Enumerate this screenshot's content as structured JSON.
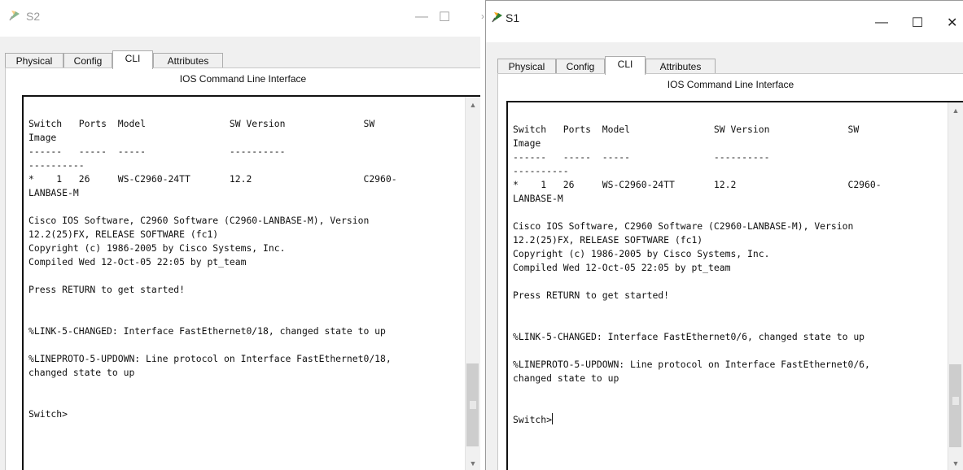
{
  "windows": [
    {
      "title": "S2",
      "controls": {
        "minimize": "—",
        "maximize": "☐"
      },
      "tabs": [
        "Physical",
        "Config",
        "CLI",
        "Attributes"
      ],
      "active_tab": "CLI",
      "panel_title": "IOS Command Line Interface",
      "terminal_text": "\nSwitch   Ports  Model               SW Version              SW\nImage\n------   -----  -----               ----------\n----------\n*    1   26     WS-C2960-24TT       12.2                    C2960-\nLANBASE-M\n\nCisco IOS Software, C2960 Software (C2960-LANBASE-M), Version\n12.2(25)FX, RELEASE SOFTWARE (fc1)\nCopyright (c) 1986-2005 by Cisco Systems, Inc.\nCompiled Wed 12-Oct-05 22:05 by pt_team\n\nPress RETURN to get started!\n\n\n%LINK-5-CHANGED: Interface FastEthernet0/18, changed state to up\n\n%LINEPROTO-5-UPDOWN: Line protocol on Interface FastEthernet0/18,\nchanged state to up\n\n\nSwitch>"
    },
    {
      "title": "S1",
      "controls": {
        "minimize": "—",
        "maximize": "☐",
        "close": "✕"
      },
      "tabs": [
        "Physical",
        "Config",
        "CLI",
        "Attributes"
      ],
      "active_tab": "CLI",
      "panel_title": "IOS Command Line Interface",
      "terminal_text": "\nSwitch   Ports  Model               SW Version              SW\nImage\n------   -----  -----               ----------\n----------\n*    1   26     WS-C2960-24TT       12.2                    C2960-\nLANBASE-M\n\nCisco IOS Software, C2960 Software (C2960-LANBASE-M), Version\n12.2(25)FX, RELEASE SOFTWARE (fc1)\nCopyright (c) 1986-2005 by Cisco Systems, Inc.\nCompiled Wed 12-Oct-05 22:05 by pt_team\n\nPress RETURN to get started!\n\n\n%LINK-5-CHANGED: Interface FastEthernet0/6, changed state to up\n\n%LINEPROTO-5-UPDOWN: Line protocol on Interface FastEthernet0/6,\nchanged state to up\n\n\nSwitch>"
    }
  ],
  "scroll_arrows": {
    "up": "▲",
    "down": "▼"
  },
  "colors": {
    "body": "#f0f0f0",
    "terminal_bg": "#ffffff",
    "terminal_border": "#111111",
    "inactive_title": "#9a9a9a"
  }
}
